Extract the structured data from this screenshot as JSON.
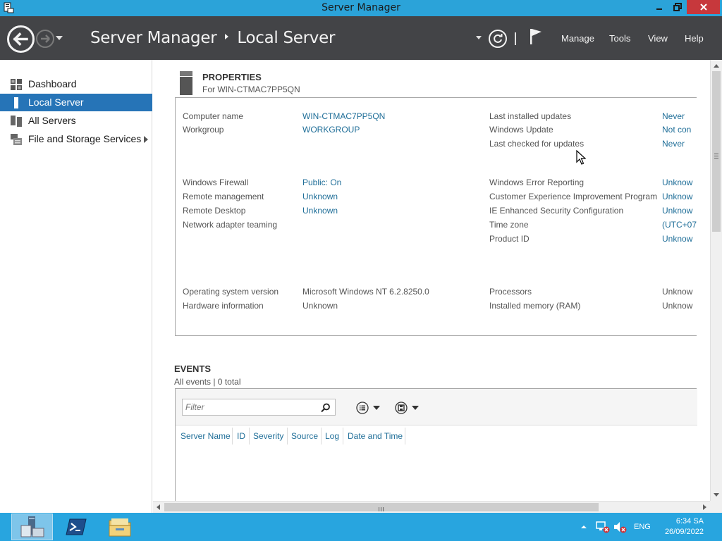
{
  "window": {
    "title": "Server Manager"
  },
  "header": {
    "app_name": "Server Manager",
    "page_name": "Local Server",
    "menu": [
      "Manage",
      "Tools",
      "View",
      "Help"
    ]
  },
  "sidebar": {
    "items": [
      {
        "label": "Dashboard",
        "icon": "dashboard-icon",
        "active": false
      },
      {
        "label": "Local Server",
        "icon": "local-server-icon",
        "active": true
      },
      {
        "label": "All Servers",
        "icon": "all-servers-icon",
        "active": false
      },
      {
        "label": "File and Storage Services",
        "icon": "file-storage-icon",
        "active": false,
        "has_submenu": true
      }
    ]
  },
  "properties": {
    "title": "PROPERTIES",
    "subtitle": "For WIN-CTMAC7PP5QN",
    "left": [
      {
        "label": "Computer name",
        "value": "WIN-CTMAC7PP5QN",
        "link": true
      },
      {
        "label": "Workgroup",
        "value": "WORKGROUP",
        "link": true
      },
      {
        "label": "Windows Firewall",
        "value": "Public: On",
        "link": true
      },
      {
        "label": "Remote management",
        "value": "Unknown",
        "link": true
      },
      {
        "label": "Remote Desktop",
        "value": "Unknown",
        "link": true
      },
      {
        "label": "Network adapter teaming",
        "value": "",
        "link": true
      },
      {
        "label": "Operating system version",
        "value": "Microsoft Windows NT 6.2.8250.0",
        "link": false
      },
      {
        "label": "Hardware information",
        "value": "Unknown",
        "link": false
      }
    ],
    "right": [
      {
        "label": "Last installed updates",
        "value": "Never",
        "link": true
      },
      {
        "label": "Windows Update",
        "value": "Not con",
        "link": true
      },
      {
        "label": "Last checked for updates",
        "value": "Never",
        "link": true
      },
      {
        "label": "Windows Error Reporting",
        "value": "Unknow",
        "link": true
      },
      {
        "label": "Customer Experience Improvement Program",
        "value": "Unknow",
        "link": true
      },
      {
        "label": "IE Enhanced Security Configuration",
        "value": "Unknow",
        "link": true
      },
      {
        "label": "Time zone",
        "value": "(UTC+07",
        "link": true
      },
      {
        "label": "Product ID",
        "value": "Unknow",
        "link": true
      },
      {
        "label": "Processors",
        "value": "Unknow",
        "link": false
      },
      {
        "label": "Installed memory (RAM)",
        "value": "Unknow",
        "link": false
      }
    ]
  },
  "events": {
    "title": "EVENTS",
    "subtitle": "All events | 0 total",
    "filter_placeholder": "Filter",
    "columns": [
      "Server Name",
      "ID",
      "Severity",
      "Source",
      "Log",
      "Date and Time"
    ]
  },
  "taskbar": {
    "apps": [
      "server-manager-icon",
      "powershell-icon",
      "file-explorer-icon"
    ],
    "language": "ENG",
    "time": "6:34 SA",
    "date": "26/09/2022"
  },
  "colors": {
    "title_bar": "#2ba3d9",
    "header": "#434447",
    "active_nav": "#2674b7",
    "link": "#1f6e98",
    "taskbar": "#28a5df",
    "close_button": "#c7383c"
  }
}
